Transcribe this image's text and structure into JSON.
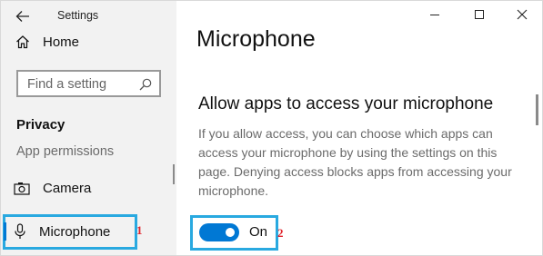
{
  "window": {
    "title": "Settings"
  },
  "sidebar": {
    "home_label": "Home",
    "search_placeholder": "Find a setting",
    "section_title": "Privacy",
    "subsection_title": "App permissions",
    "items": [
      {
        "label": "Camera",
        "icon": "camera-icon"
      },
      {
        "label": "Microphone",
        "icon": "microphone-icon",
        "selected": true
      }
    ]
  },
  "main": {
    "page_title": "Microphone",
    "heading": "Allow apps to access your microphone",
    "description": "If you allow access, you can choose which apps can access your microphone by using the settings on this page. Denying access blocks apps from accessing your microphone.",
    "toggle": {
      "state_label": "On",
      "checked": true
    }
  },
  "annotations": {
    "badge_1": "1",
    "badge_2": "2"
  },
  "colors": {
    "accent": "#0078d4",
    "highlight_box": "#29a9e0",
    "badge": "#e0242c"
  }
}
